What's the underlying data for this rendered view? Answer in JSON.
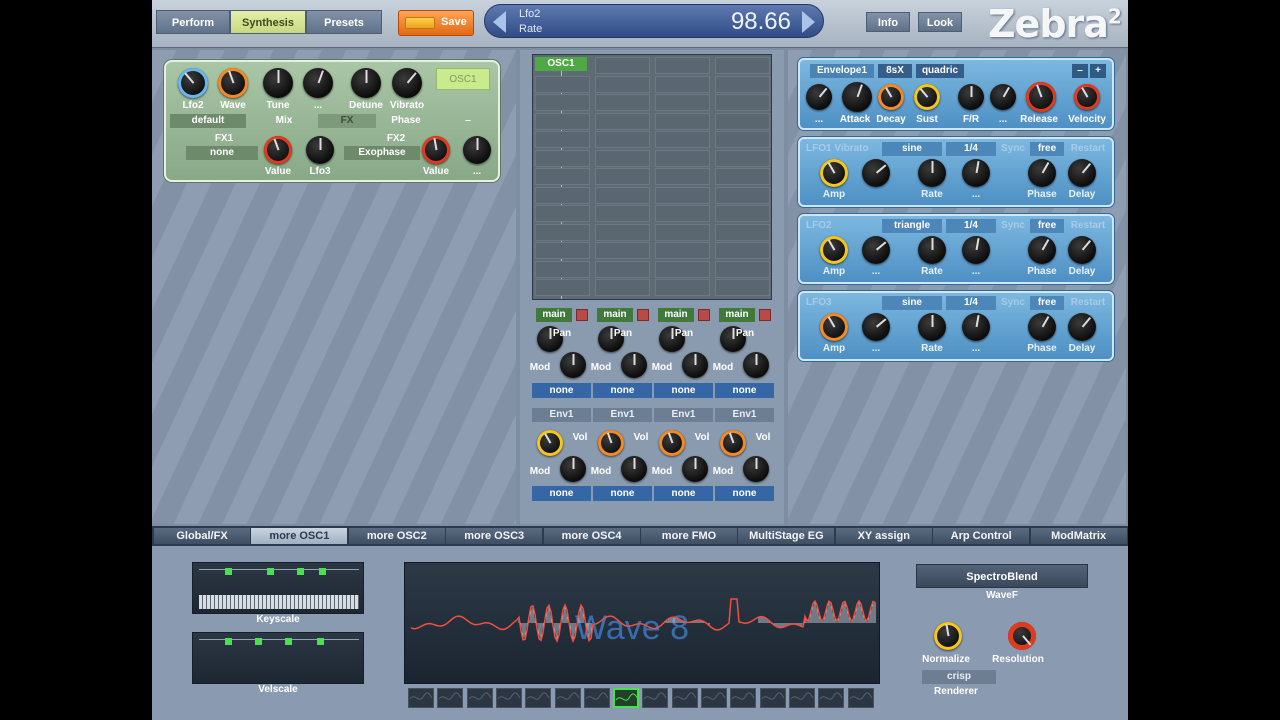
{
  "top": {
    "tabs": [
      "Perform",
      "Synthesis",
      "Presets"
    ],
    "active": "Synthesis",
    "save": "Save",
    "param_name": "Lfo2",
    "param_sub": "Rate",
    "param_value": "98.66",
    "info": "Info",
    "look": "Look",
    "logo": "Zebra",
    "logo_sup": "2"
  },
  "osc_panel": {
    "title": "OSC1",
    "knobs": [
      "Lfo2",
      "Wave",
      "Tune",
      "...",
      "Detune",
      "Vibrato"
    ],
    "row2": [
      "default",
      "Mix",
      "FX",
      "Phase",
      "–"
    ],
    "fx1_label": "FX1",
    "fx1_value": "none",
    "fx2_label": "FX2",
    "fx2_value": "Exophase",
    "fx_knob_labels": [
      "Value",
      "Lfo3",
      "Value",
      "..."
    ]
  },
  "grid": {
    "label": "OSC1",
    "outs": [
      "main",
      "main",
      "main",
      "main"
    ],
    "pan": "Pan",
    "mod": "Mod",
    "vol": "Vol",
    "none": "none",
    "env": "Env1"
  },
  "envelope": {
    "title": "Envelope1",
    "mode": "8sX",
    "curve": "quadric",
    "minus": "–",
    "plus": "+",
    "knobs": [
      "...",
      "Attack",
      "Decay",
      "Sust",
      "F/R",
      "...",
      "Release",
      "Velocity"
    ]
  },
  "lfos": [
    {
      "title": "LFO1 Vibrato",
      "wave": "sine",
      "rate": "1/4",
      "sync": "Sync",
      "trig": "free",
      "restart": "Restart",
      "knobs": [
        "Amp",
        "",
        "Rate",
        "...",
        "Phase",
        "Delay"
      ]
    },
    {
      "title": "LFO2",
      "wave": "triangle",
      "rate": "1/4",
      "sync": "Sync",
      "trig": "free",
      "restart": "Restart",
      "knobs": [
        "Amp",
        "...",
        "Rate",
        "...",
        "Phase",
        "Delay"
      ]
    },
    {
      "title": "LFO3",
      "wave": "sine",
      "rate": "1/4",
      "sync": "Sync",
      "trig": "free",
      "restart": "Restart",
      "knobs": [
        "Amp",
        "...",
        "Rate",
        "...",
        "Phase",
        "Delay"
      ]
    }
  ],
  "tabs": [
    "Global/FX",
    "more OSC1",
    "more OSC2",
    "more OSC3",
    "more OSC4",
    "more FMO",
    "MultiStage EG",
    "XY assign",
    "Arp Control",
    "ModMatrix"
  ],
  "active_tab": "more OSC1",
  "bottom": {
    "keyscale": "Keyscale",
    "velscale": "Velscale",
    "wave_label": "Wave 8",
    "spectro": "SpectroBlend",
    "wavef": "WaveF",
    "normalize": "Normalize",
    "resolution": "Resolution",
    "renderer_value": "crisp",
    "renderer": "Renderer",
    "selected_wave": 8
  }
}
